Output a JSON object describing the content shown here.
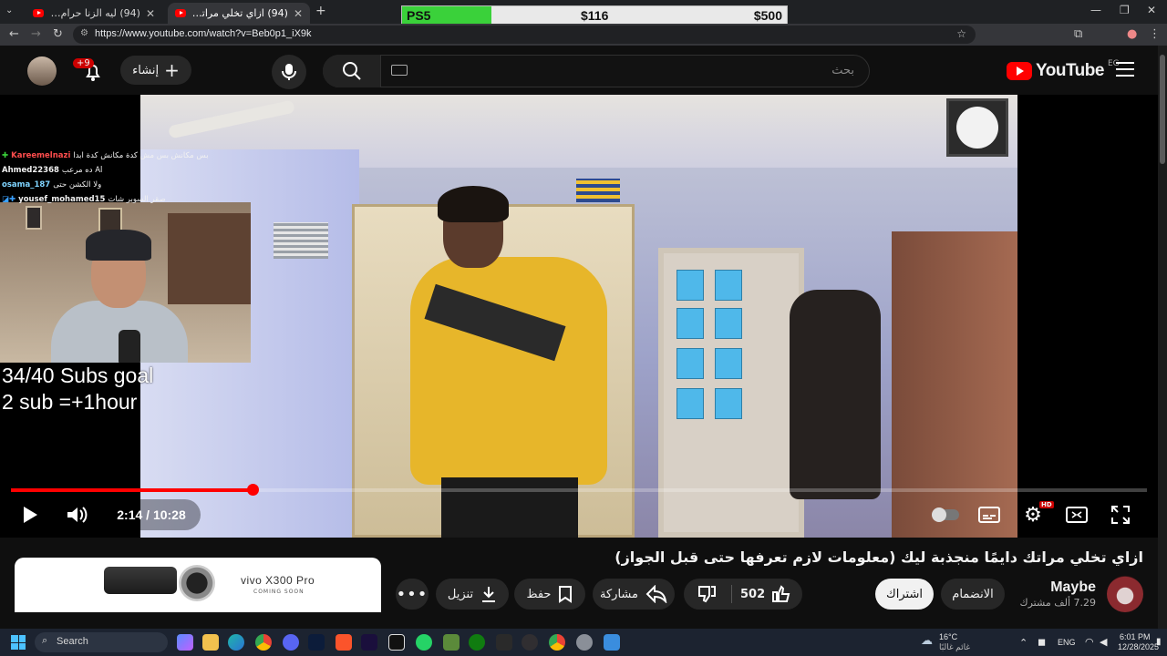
{
  "browser": {
    "tabs": [
      {
        "title": "(94) ليه الزنا حرام؟ (مش هتكلم د..."
      },
      {
        "title": "(94) ازاي تخلي مراتك دايمًا منجذ..."
      }
    ],
    "url": "https://www.youtube.com/watch?v=Beb0p1_iX9k"
  },
  "goal_bar": {
    "label": "PS5",
    "current": "$116",
    "target": "$500",
    "progress": 0.232,
    "fill_color": "#3ad13a"
  },
  "youtube": {
    "logo_text": "YouTube",
    "region": "EG",
    "search_placeholder": "بحث",
    "create_label": "إنشاء",
    "notification_count": "+9",
    "accent_color": "#ff0000"
  },
  "stream_overlay": {
    "chat": [
      {
        "user": "Kareemelnazi",
        "message": "بس مكانش بس مش كدة مكانش كدة ابدا",
        "user_color": "#ff4d4d"
      },
      {
        "user": "Ahmed22368",
        "message": "ده مرعب Al",
        "user_color": "#ffffff"
      },
      {
        "user": "osama_187",
        "message": "ولا الكشن حتى",
        "user_color": "#7fd4ff"
      },
      {
        "user": "yousef_mohamed15",
        "message": "صقر السوبر شات",
        "user_color": "#ffffff"
      }
    ],
    "sub_goal_line1": "34/40 Subs goal",
    "sub_goal_line2": "2 sub =+1hour"
  },
  "player": {
    "current_time": "2:14",
    "duration": "10:28",
    "time_display": "2:14 / 10:28",
    "progress": 0.213,
    "quality_badge": "HD"
  },
  "video": {
    "title": "ازاي تخلي مراتك دايمًا منجذبة ليك (معلومات لازم تعرفها حتى قبل الجواز)",
    "channel_name": "Maybe",
    "subscriber_count": "7.29 ألف مشترك",
    "subscribe_label": "اشتراك",
    "join_label": "الانضمام",
    "like_count": "502",
    "share_label": "مشاركة",
    "save_label": "حفظ",
    "download_label": "تنزيل"
  },
  "ad": {
    "brand": "vivo X300 Pro",
    "tagline": "COMING SOON"
  },
  "taskbar": {
    "search_label": "Search",
    "weather_temp": "16°C",
    "weather_desc": "غائم غالبًا",
    "lang": "ENG",
    "time": "6:01 PM",
    "date": "12/28/2025"
  }
}
